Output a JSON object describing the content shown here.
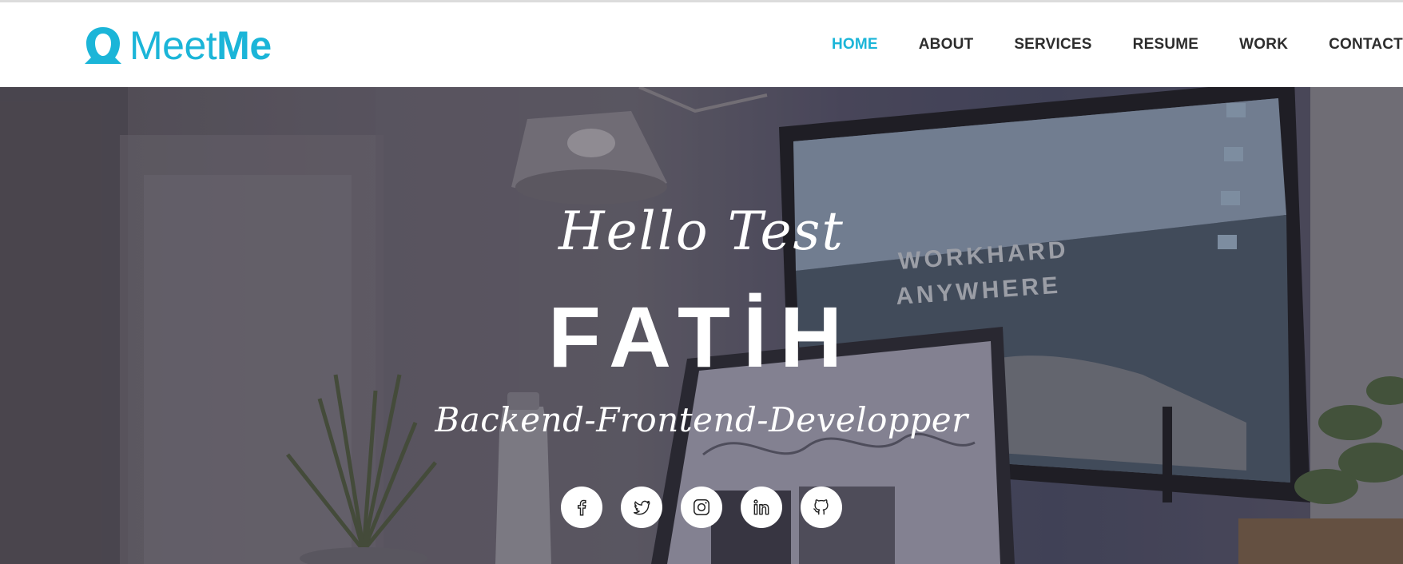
{
  "brand": {
    "name_light": "Meet",
    "name_bold": "Me",
    "color": "#1bb5d8",
    "icon": "user-silhouette-icon"
  },
  "nav": {
    "items": [
      {
        "label": "HOME",
        "active": true
      },
      {
        "label": "ABOUT",
        "active": false
      },
      {
        "label": "SERVICES",
        "active": false
      },
      {
        "label": "RESUME",
        "active": false
      },
      {
        "label": "WORK",
        "active": false
      },
      {
        "label": "CONTACT",
        "active": false
      }
    ]
  },
  "hero": {
    "greeting": "Hello Test",
    "name": "FATİH",
    "role": "Backend-Frontend-Developper",
    "screen_text_line1": "WORKHARD",
    "screen_text_line2": "ANYWHERE"
  },
  "social": [
    {
      "icon": "facebook-icon"
    },
    {
      "icon": "twitter-icon"
    },
    {
      "icon": "instagram-icon"
    },
    {
      "icon": "linkedin-icon"
    },
    {
      "icon": "github-icon"
    }
  ]
}
